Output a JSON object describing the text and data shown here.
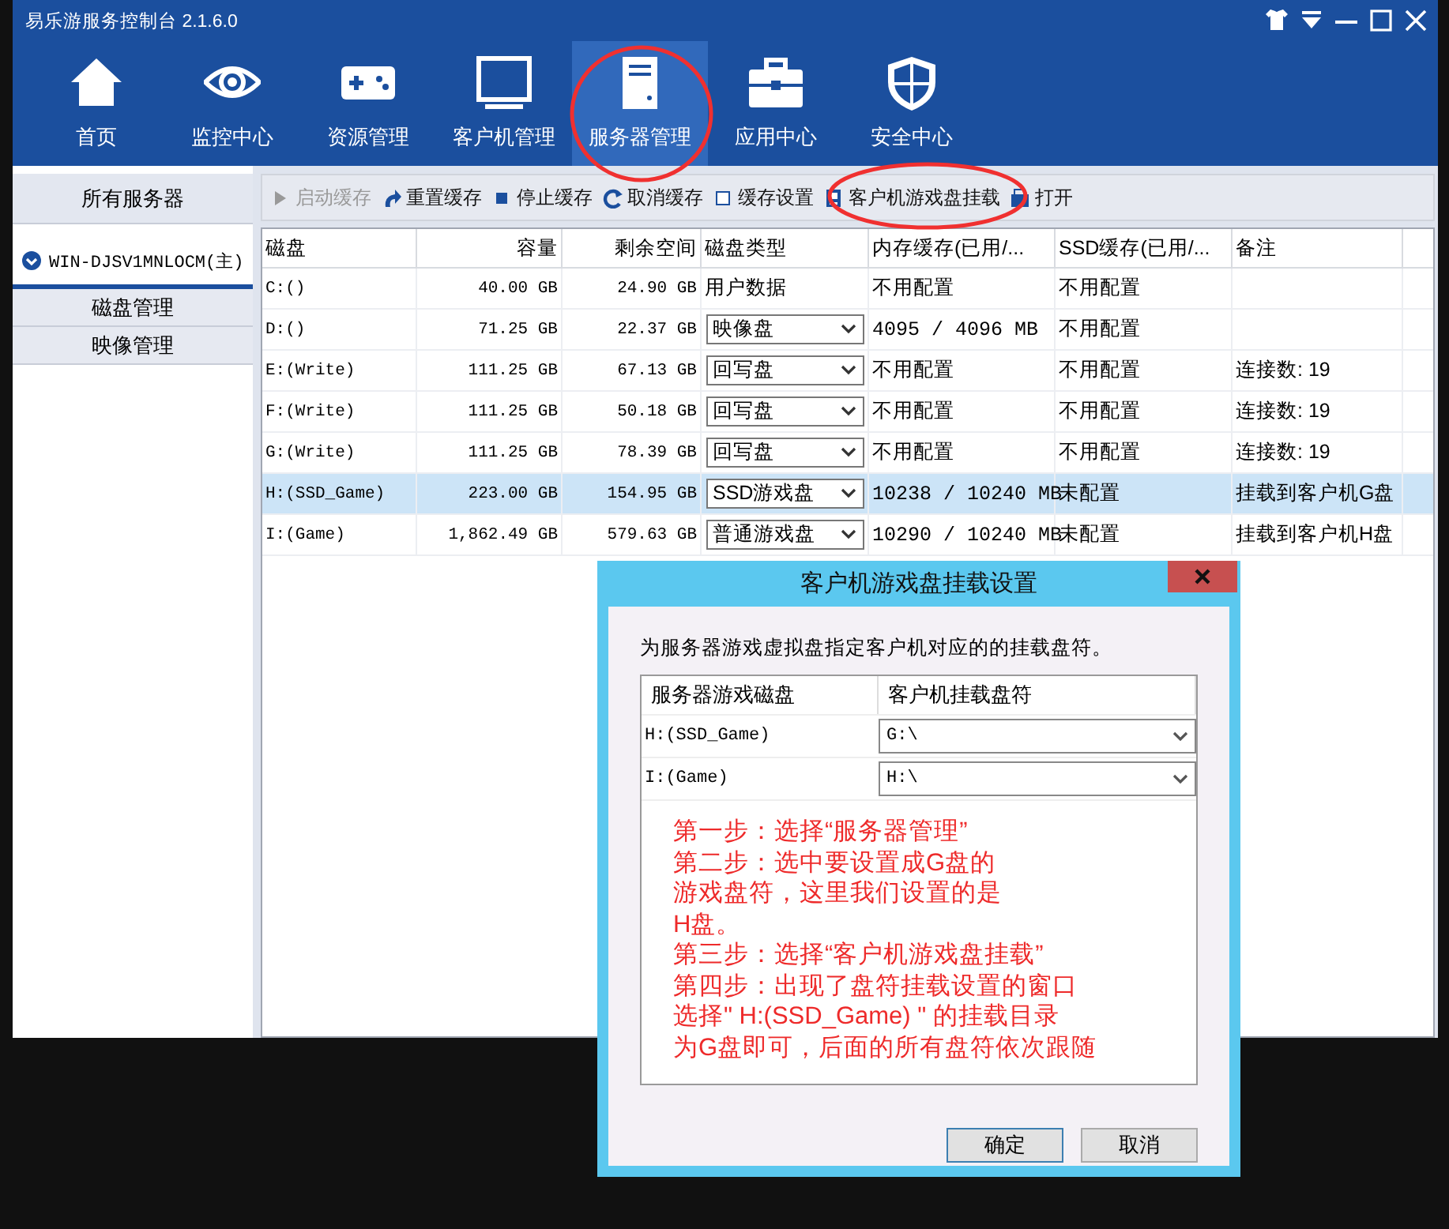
{
  "window": {
    "title": "易乐游服务控制台 2.1.6.0"
  },
  "nav_tabs": [
    {
      "label": "首页",
      "selected": false
    },
    {
      "label": "监控中心",
      "selected": false
    },
    {
      "label": "资源管理",
      "selected": false
    },
    {
      "label": "客户机管理",
      "selected": false
    },
    {
      "label": "服务器管理",
      "selected": true
    },
    {
      "label": "应用中心",
      "selected": false
    },
    {
      "label": "安全中心",
      "selected": false
    }
  ],
  "sidebar": {
    "header": "所有服务器",
    "server": {
      "label": "WIN-DJSV1MNLOCM(主)",
      "expanded": true
    },
    "items": [
      {
        "label": "磁盘管理",
        "selected": false
      },
      {
        "label": "映像管理",
        "selected": false
      }
    ]
  },
  "toolbar": [
    {
      "label": "启动缓存",
      "disabled": true
    },
    {
      "label": "重置缓存",
      "disabled": false
    },
    {
      "label": "停止缓存",
      "disabled": false
    },
    {
      "label": "取消缓存",
      "disabled": false
    },
    {
      "label": "缓存设置",
      "disabled": false
    },
    {
      "label": "客户机游戏盘挂载",
      "disabled": false
    },
    {
      "label": "打开",
      "disabled": false
    }
  ],
  "table": {
    "columns": [
      "磁盘",
      "容量",
      "剩余空间",
      "磁盘类型",
      "内存缓存(已用/...",
      "SSD缓存(已用/...",
      "备注"
    ],
    "rows": [
      {
        "disk": "C:()",
        "capacity": "40.00 GB",
        "free": "24.90 GB",
        "disk_type": {
          "kind": "text",
          "value": "用户数据"
        },
        "memory_cache": "不用配置",
        "ssd_cache": "不用配置",
        "note": "",
        "selected": false
      },
      {
        "disk": "D:()",
        "capacity": "71.25 GB",
        "free": "22.37 GB",
        "disk_type": {
          "kind": "dropdown",
          "value": "映像盘"
        },
        "memory_cache": "4095 / 4096 MB",
        "ssd_cache": "不用配置",
        "note": "",
        "selected": false
      },
      {
        "disk": "E:(Write)",
        "capacity": "111.25 GB",
        "free": "67.13 GB",
        "disk_type": {
          "kind": "dropdown",
          "value": "回写盘"
        },
        "memory_cache": "不用配置",
        "ssd_cache": "不用配置",
        "note": "连接数: 19",
        "selected": false
      },
      {
        "disk": "F:(Write)",
        "capacity": "111.25 GB",
        "free": "50.18 GB",
        "disk_type": {
          "kind": "dropdown",
          "value": "回写盘"
        },
        "memory_cache": "不用配置",
        "ssd_cache": "不用配置",
        "note": "连接数: 19",
        "selected": false
      },
      {
        "disk": "G:(Write)",
        "capacity": "111.25 GB",
        "free": "78.39 GB",
        "disk_type": {
          "kind": "dropdown",
          "value": "回写盘"
        },
        "memory_cache": "不用配置",
        "ssd_cache": "不用配置",
        "note": "连接数: 19",
        "selected": false
      },
      {
        "disk": "H:(SSD_Game)",
        "capacity": "223.00 GB",
        "free": "154.95 GB",
        "disk_type": {
          "kind": "dropdown",
          "value": "SSD游戏盘"
        },
        "memory_cache": "10238 / 10240 MB",
        "ssd_cache": "未配置",
        "note": "挂载到客户机G盘",
        "selected": true
      },
      {
        "disk": "I:(Game)",
        "capacity": "1,862.49 GB",
        "free": "579.63 GB",
        "disk_type": {
          "kind": "dropdown",
          "value": "普通游戏盘"
        },
        "memory_cache": "10290 / 10240 MB",
        "ssd_cache": "未配置",
        "note": "挂载到客户机H盘",
        "selected": false
      }
    ]
  },
  "dialog": {
    "title": "客户机游戏盘挂载设置",
    "description": "为服务器游戏虚拟盘指定客户机对应的的挂载盘符。",
    "columns": [
      "服务器游戏磁盘",
      "客户机挂载盘符"
    ],
    "rows": [
      {
        "disk": "H:(SSD_Game)",
        "letter": "G:\\"
      },
      {
        "disk": "I:(Game)",
        "letter": "H:\\"
      }
    ],
    "buttons": [
      {
        "label": "确定",
        "kind": "default"
      },
      {
        "label": "取消",
        "kind": "normal"
      }
    ]
  },
  "annotation_text": [
    "第一步：选择“服务器管理”",
    "第二步：选中要设置成G盘的",
    "游戏盘符，这里我们设置的是",
    "H盘。",
    "第三步：选择“客户机游戏盘挂载”",
    "第四步：出现了盘符挂载设置的窗口",
    "选择\" H:(SSD_Game) \" 的挂载目录",
    "为G盘即可，后面的所有盘符依次跟随"
  ]
}
